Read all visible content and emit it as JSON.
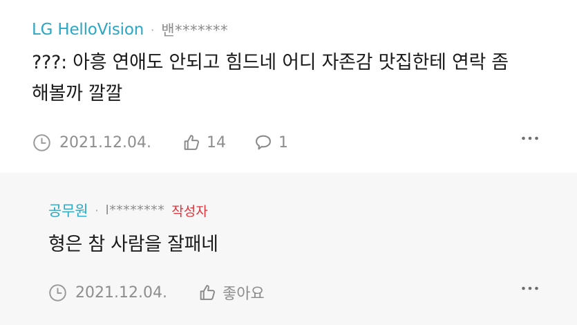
{
  "comment": {
    "author": "LG HelloVision",
    "separator": "·",
    "user_masked": "밴*******",
    "text": "???: 아흥 연애도 안되고 힘드네 어디 자존감 맛집한테 연락 좀 해볼까 깔깔",
    "date": "2021.12.04.",
    "like_count": "14",
    "reply_count": "1",
    "icons": {
      "clock": "clock-icon",
      "like": "thumbs-up-icon",
      "reply": "speech-bubble-icon",
      "more": "more-dots-icon"
    }
  },
  "reply": {
    "author": "공무원",
    "separator": "·",
    "user_masked": "l********",
    "writer_badge": "작성자",
    "text": "형은 참 사람을 잘패네",
    "date": "2021.12.04.",
    "like_label": "좋아요",
    "icons": {
      "clock": "clock-icon",
      "like": "thumbs-up-icon",
      "more": "more-dots-icon"
    }
  },
  "colors": {
    "author": "#2aa7c5",
    "writer_badge": "#e0343a",
    "meta_text": "#8d8d8d",
    "body_text": "#1a1a1a",
    "reply_background": "#f7f7f7",
    "page_background": "#ffffff"
  }
}
